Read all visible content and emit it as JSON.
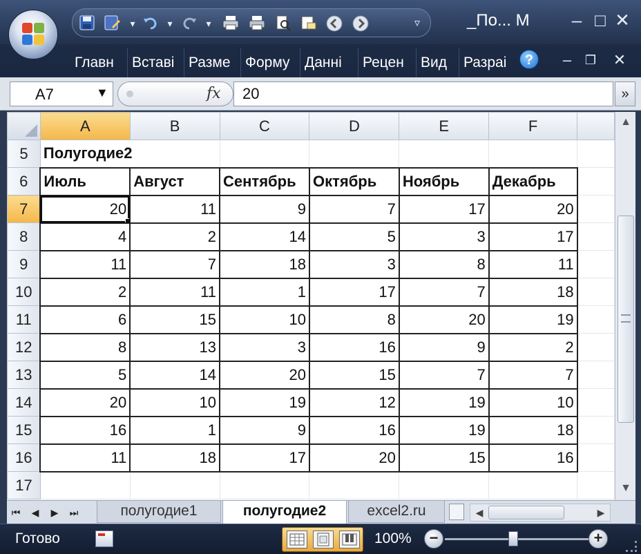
{
  "window": {
    "title_short": "_По...",
    "title_suffix": "M",
    "minimize": "–",
    "restore": "□",
    "close": "✕"
  },
  "ribbon": {
    "tabs": [
      "Главн",
      "Вставі",
      "Разме",
      "Форму",
      "Данні",
      "Рецен",
      "Вид",
      "Разраі"
    ],
    "help": "?",
    "min": "–",
    "restore": "❐",
    "close": "✕"
  },
  "formula_bar": {
    "name_box": "A7",
    "fx_label": "fx",
    "formula": "20"
  },
  "columns": [
    "A",
    "B",
    "C",
    "D",
    "E",
    "F"
  ],
  "sheet": {
    "title_row": {
      "row": "5",
      "text": "Полугодие2"
    },
    "header_row": {
      "row": "6",
      "cells": [
        "Июль",
        "Август",
        "Сентябрь",
        "Октябрь",
        "Ноябрь",
        "Декабрь"
      ]
    },
    "data_rows": [
      {
        "row": "7",
        "cells": [
          "20",
          "11",
          "9",
          "7",
          "17",
          "20"
        ]
      },
      {
        "row": "8",
        "cells": [
          "4",
          "2",
          "14",
          "5",
          "3",
          "17"
        ]
      },
      {
        "row": "9",
        "cells": [
          "11",
          "7",
          "18",
          "3",
          "8",
          "11"
        ]
      },
      {
        "row": "10",
        "cells": [
          "2",
          "11",
          "1",
          "17",
          "7",
          "18"
        ]
      },
      {
        "row": "11",
        "cells": [
          "6",
          "15",
          "10",
          "8",
          "20",
          "19"
        ]
      },
      {
        "row": "12",
        "cells": [
          "8",
          "13",
          "3",
          "16",
          "9",
          "2"
        ]
      },
      {
        "row": "13",
        "cells": [
          "5",
          "14",
          "20",
          "15",
          "7",
          "7"
        ]
      },
      {
        "row": "14",
        "cells": [
          "20",
          "10",
          "19",
          "12",
          "19",
          "10"
        ]
      },
      {
        "row": "15",
        "cells": [
          "16",
          "1",
          "9",
          "16",
          "19",
          "18"
        ]
      },
      {
        "row": "16",
        "cells": [
          "11",
          "18",
          "17",
          "20",
          "15",
          "16"
        ]
      }
    ],
    "empty_row": "17",
    "active_cell": "A7"
  },
  "sheet_tabs": [
    {
      "label": "полугодие1",
      "active": false
    },
    {
      "label": "полугодие2",
      "active": true
    },
    {
      "label": "excel2.ru",
      "active": false
    }
  ],
  "status": {
    "ready": "Готово",
    "zoom": "100%",
    "zoom_minus": "−",
    "zoom_plus": "+"
  },
  "colors": {
    "selection_header": "#f4b74a",
    "chrome_dark": "#1d2b45"
  }
}
